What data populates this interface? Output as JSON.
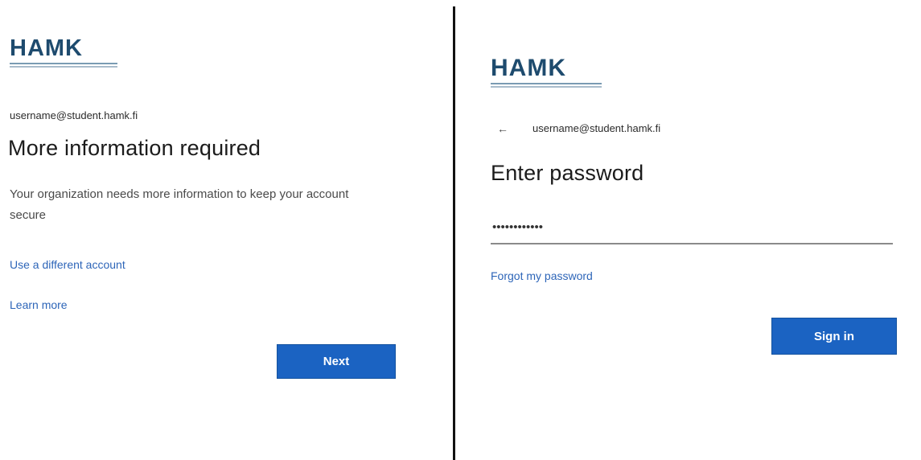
{
  "left_panel": {
    "logo_text": "HAMK",
    "email": "username@student.hamk.fi",
    "title": "More information required",
    "description": "Your organization needs more information to keep your account secure",
    "links": [
      "Use a different account",
      "Learn more"
    ],
    "next_button_label": "Next"
  },
  "right_panel": {
    "logo_text": "HAMK",
    "back_icon": "←",
    "email": "username@student.hamk.fi",
    "title": "Enter password",
    "password_value": "••••••••••••",
    "forgot_link": "Forgot my password",
    "sign_in_button_label": "Sign in"
  },
  "colors": {
    "accent": "#1b63c2",
    "link": "#2d65b8",
    "logo": "#1e4b6e"
  }
}
